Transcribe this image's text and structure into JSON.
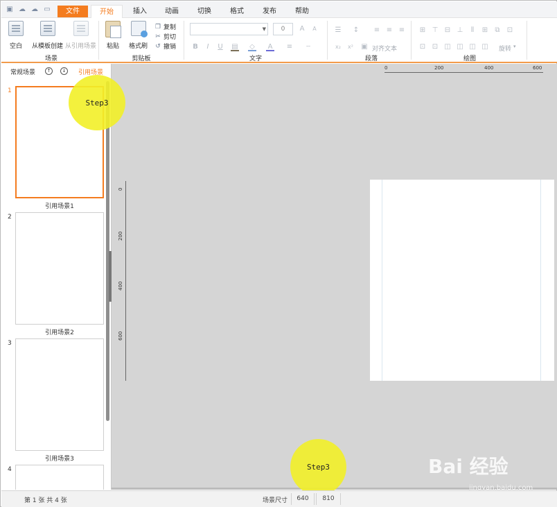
{
  "tabs": [
    {
      "label": "文件",
      "kind": "file"
    },
    {
      "label": "开始",
      "kind": "active"
    },
    {
      "label": "插入",
      "kind": "normal"
    },
    {
      "label": "动画",
      "kind": "normal"
    },
    {
      "label": "切换",
      "kind": "normal"
    },
    {
      "label": "格式",
      "kind": "normal"
    },
    {
      "label": "发布",
      "kind": "normal"
    },
    {
      "label": "帮助",
      "kind": "normal"
    }
  ],
  "ribbon": {
    "scene": {
      "label": "场景",
      "blank": "空白",
      "from_template": "从模板创建",
      "from_ref": "从引用场景"
    },
    "clipboard": {
      "label": "剪贴板",
      "paste": "粘贴",
      "format_painter": "格式刷",
      "copy": "复制",
      "cut": "剪切",
      "undo": "撤销"
    },
    "text": {
      "label": "文字",
      "font_size": "0",
      "bold": "B",
      "italic": "I",
      "underline": "U"
    },
    "paragraph": {
      "label": "段落",
      "align_text": "对齐文本"
    },
    "drawing": {
      "label": "绘图",
      "rotate": "旋转"
    }
  },
  "sidebar": {
    "tab_normal": "常规场景",
    "tab_ref": "引用场景",
    "up_btn": "↑",
    "down_btn": "↓",
    "slides": [
      {
        "num": "1",
        "name": "引用场景1"
      },
      {
        "num": "2",
        "name": "引用场景2"
      },
      {
        "num": "3",
        "name": "引用场景3"
      },
      {
        "num": "4",
        "name": ""
      }
    ]
  },
  "rulers": {
    "h_ticks": [
      "0",
      "200",
      "400",
      "600"
    ],
    "v_ticks": [
      "0",
      "200",
      "400",
      "600"
    ]
  },
  "steps": [
    "Step3",
    "Step3"
  ],
  "status": {
    "page_info": "第 1 张  共 4 张",
    "scene_size_label": "场景尺寸",
    "width": "640",
    "height": "810"
  },
  "watermark": {
    "text": "Bai 经验",
    "url": "jingyan.baidu.com"
  },
  "colors": {
    "accent": "#f47c1f",
    "highlight": "#f2f028"
  }
}
